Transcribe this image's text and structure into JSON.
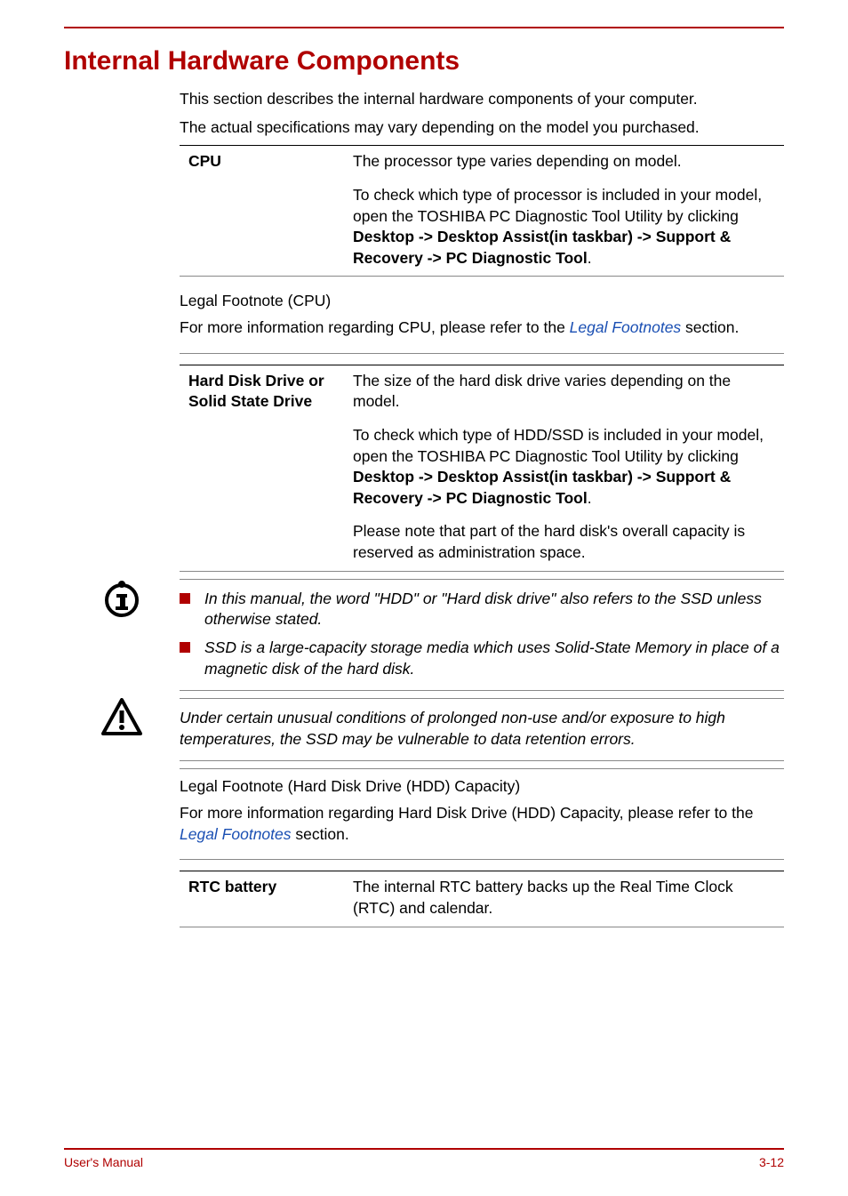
{
  "heading": "Internal Hardware Components",
  "intro": {
    "p1": "This section describes the internal hardware components of your computer.",
    "p2": "The actual specifications may vary depending on the model you purchased."
  },
  "cpu": {
    "label": "CPU",
    "p1": "The processor type varies depending on model.",
    "p2a": "To check which type of processor is included in your model, open the TOSHIBA PC Diagnostic Tool Utility by clicking ",
    "p2b": "Desktop -> Desktop Assist(in taskbar) -> Support & Recovery -> PC Diagnostic Tool",
    "p2c": "."
  },
  "cpu_footnote": {
    "title": "Legal Footnote (CPU)",
    "text_a": "For more information regarding CPU, please refer to the ",
    "link": "Legal Footnotes",
    "text_b": " section."
  },
  "hdd": {
    "label": "Hard Disk Drive or Solid State Drive",
    "p1": "The size of the hard disk drive varies depending on the model.",
    "p2a": "To check which type of HDD/SSD is included in your model, open the TOSHIBA PC Diagnostic Tool Utility by clicking ",
    "p2b": "Desktop -> Desktop Assist(in taskbar) -> Support & Recovery -> PC Diagnostic Tool",
    "p2c": ".",
    "p3": "Please note that part of the hard disk's overall capacity is reserved as administration space."
  },
  "info_note": {
    "li1": "In this manual, the word \"HDD\" or \"Hard disk drive\" also refers to the SSD unless otherwise stated.",
    "li2": "SSD is a large-capacity storage media which uses Solid-State Memory in place of a magnetic disk of the hard disk."
  },
  "warn_note": {
    "text": "Under certain unusual conditions of prolonged non-use and/or exposure to high temperatures, the SSD may be vulnerable to data retention errors."
  },
  "hdd_footnote": {
    "title": "Legal Footnote (Hard Disk Drive (HDD) Capacity)",
    "text_a": "For more information regarding Hard Disk Drive (HDD) Capacity, please refer to the ",
    "link": "Legal Footnotes",
    "text_b": " section."
  },
  "rtc": {
    "label": "RTC battery",
    "text": "The internal RTC battery backs up the Real Time Clock (RTC) and calendar."
  },
  "footer": {
    "left": "User's Manual",
    "right": "3-12"
  }
}
